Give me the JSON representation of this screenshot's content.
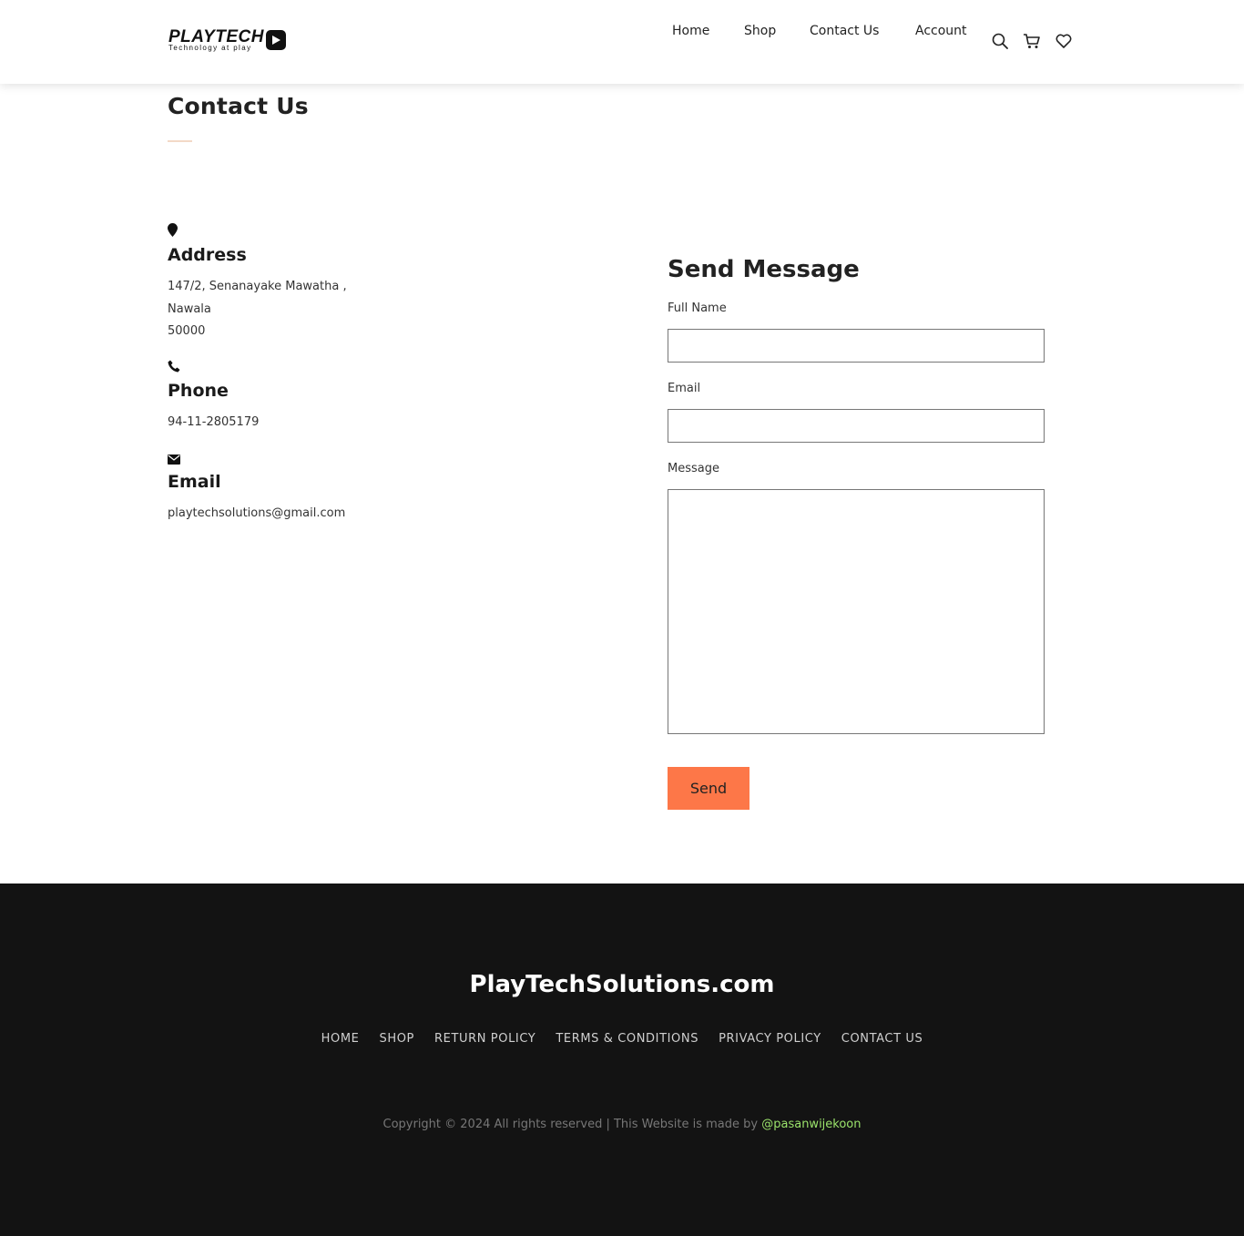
{
  "header": {
    "logo": {
      "name": "PLAYTECH",
      "tagline": "Technology at play"
    },
    "nav": [
      {
        "label": "Home"
      },
      {
        "label": "Shop"
      },
      {
        "label": "Contact Us"
      },
      {
        "label": "Account"
      }
    ],
    "icons": [
      "search-icon",
      "cart-icon",
      "heart-icon"
    ]
  },
  "page": {
    "title": "Contact Us"
  },
  "contact_info": {
    "address": {
      "icon": "map-pin-icon",
      "heading": "Address",
      "lines": [
        "147/2, Senanayake Mawatha ,",
        "Nawala",
        "50000"
      ]
    },
    "phone": {
      "icon": "phone-icon",
      "heading": "Phone",
      "value": "94-11-2805179"
    },
    "email": {
      "icon": "envelope-icon",
      "heading": "Email",
      "value": "playtechsolutions@gmail.com"
    }
  },
  "form": {
    "title": "Send Message",
    "fields": {
      "full_name": {
        "label": "Full Name",
        "value": ""
      },
      "email": {
        "label": "Email",
        "value": ""
      },
      "message": {
        "label": "Message",
        "value": ""
      }
    },
    "submit_label": "Send",
    "submit_color": "#fd7748"
  },
  "footer": {
    "brand": "PlayTechSolutions.com",
    "links": [
      "HOME",
      "SHOP",
      "RETURN POLICY",
      "TERMS & CONDITIONS",
      "PRIVACY POLICY",
      "CONTACT US"
    ],
    "copyright": "Copyright © 2024 All rights reserved | This Website is made by",
    "author_handle": "@pasanwijekoon",
    "background": "#131313",
    "handle_color": "#9be36b"
  }
}
